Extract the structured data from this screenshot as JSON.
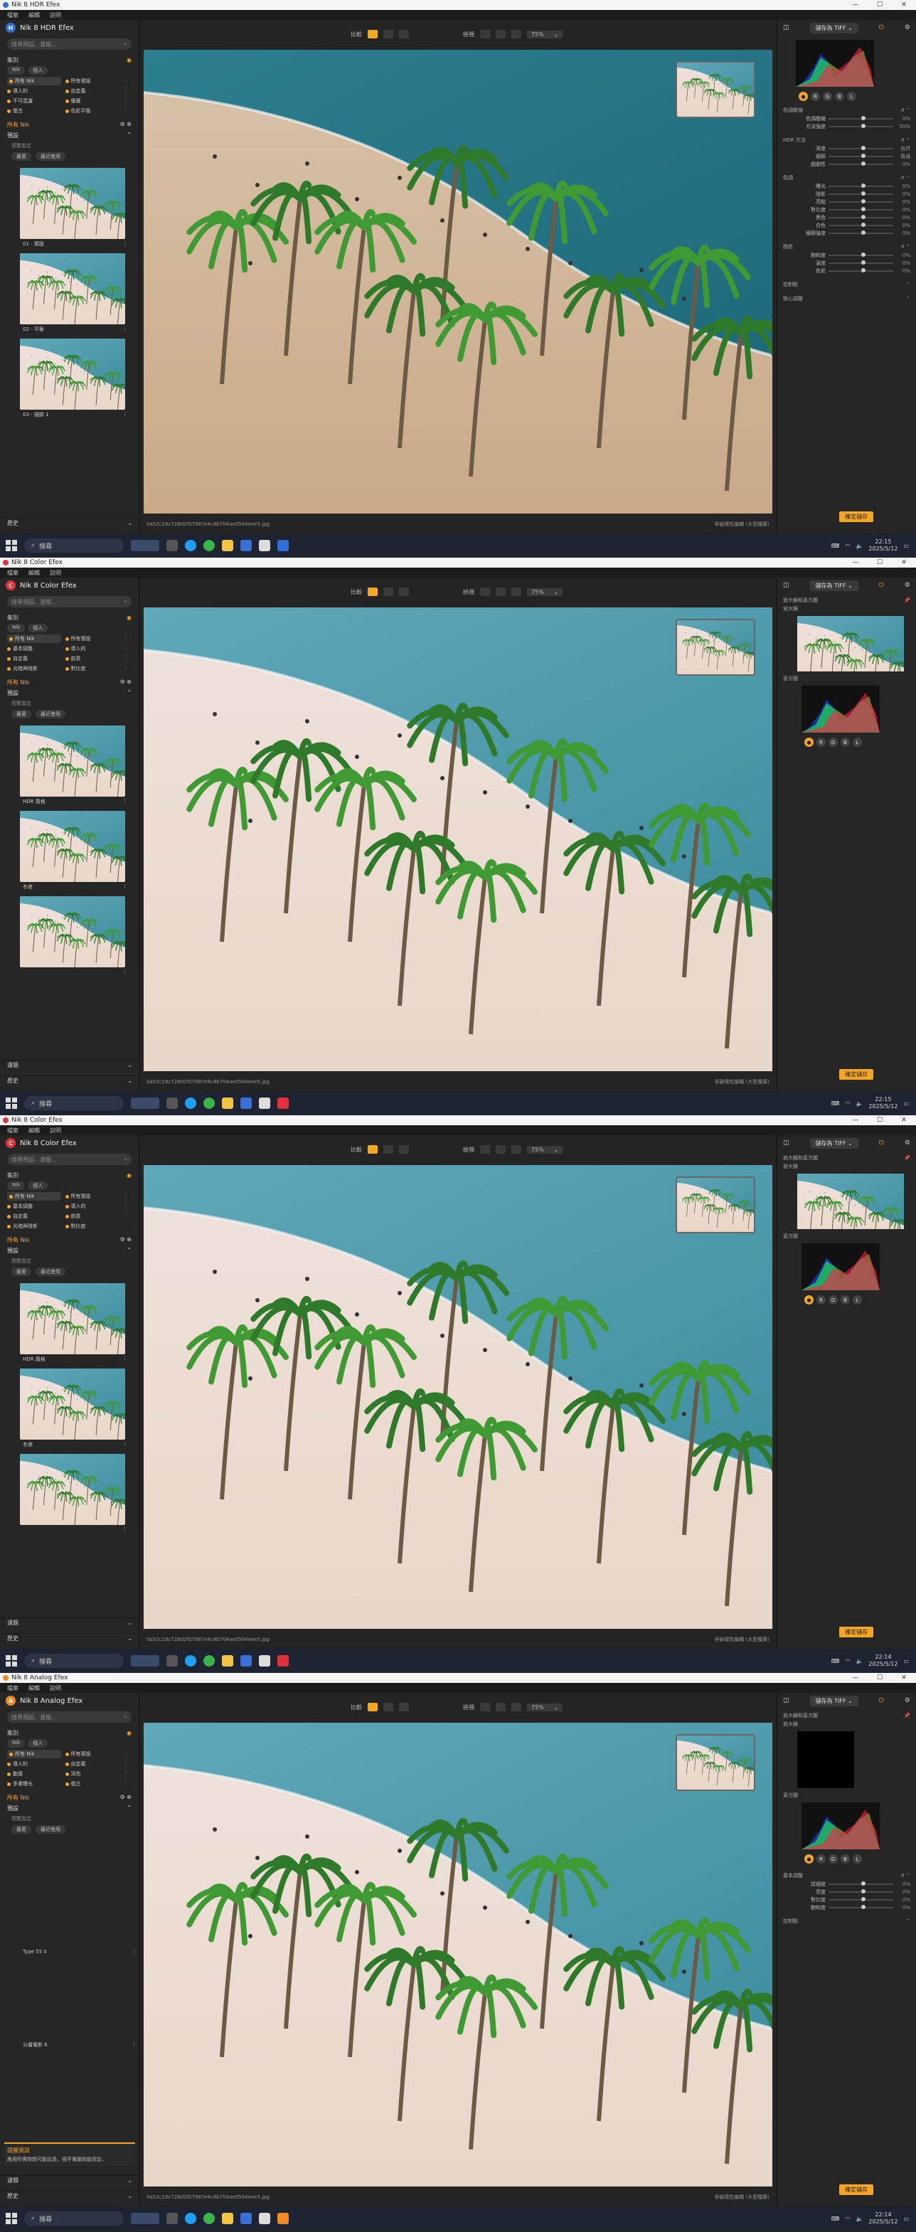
{
  "windows": [
    {
      "title": "Nik 8 HDR Efex",
      "product": "Nik 8 HDR Efex",
      "product_letter": "H",
      "accent": "#2f6fd8",
      "menu": [
        "檔案",
        "編輯",
        "說明"
      ],
      "search_placeholder": "搜尋預設、濾鏡...",
      "collection_label": "集別",
      "tabs": [
        "Nik",
        "個人"
      ],
      "filters": [
        "所有 Nik",
        "所有預設",
        "導入的",
        "自定義",
        "不可混濾",
        "優雅",
        "復古",
        "色彩平衡"
      ],
      "nik_label": "所有 Nik",
      "presets_label": "預設",
      "presets_sub": "預覽設定",
      "preset_pills": [
        "最愛",
        "最近使用"
      ],
      "thumbs": [
        "01 - 預設",
        "02 - 平衡",
        "03 - 細節 1"
      ],
      "bottom_labels": [
        "歷史"
      ],
      "toolbar_compare": "比較",
      "toolbar_view": "檢視",
      "zoom": "75%",
      "filename": "0a52c19c728d2f07987e4c8b704ae0504eee5.jpg",
      "status_right": "非破壞性編輯 (大型檔案)",
      "save_label": "儲存為 TIFF",
      "apply_label": "確定儲存",
      "right_groups": [
        {
          "title": "色調壓縮",
          "rows": [
            [
              "色調壓縮",
              "0%"
            ],
            [
              "方法強度",
              "50%"
            ]
          ]
        },
        {
          "title": "HDR 方法",
          "rows": [
            [
              "深度",
              "自然"
            ],
            [
              "細節",
              "普通"
            ],
            [
              "戲劇性",
              "0%"
            ]
          ]
        },
        {
          "title": "色調",
          "rows": [
            [
              "曝光",
              "0%"
            ],
            [
              "陰影",
              "0%"
            ],
            [
              "亮點",
              "0%"
            ],
            [
              "對比度",
              "0%"
            ],
            [
              "黑色",
              "0%"
            ],
            [
              "白色",
              "0%"
            ],
            [
              "細節強度",
              "0%"
            ]
          ]
        },
        {
          "title": "顏色",
          "rows": [
            [
              "飽和度",
              "0%"
            ],
            [
              "溫度",
              "0%"
            ],
            [
              "色彩",
              "0%"
            ]
          ]
        }
      ],
      "right_footer": [
        "控制點",
        "核心調整"
      ],
      "clock_time": "22:15",
      "clock_date": "2025/5/12",
      "search_label": "搜尋"
    },
    {
      "title": "Nik 8 Color Efex",
      "product": "Nik 8 Color Efex",
      "product_letter": "C",
      "accent": "#e0303a",
      "menu": [
        "檔案",
        "編輯",
        "說明"
      ],
      "search_placeholder": "搜尋預設、濾鏡...",
      "collection_label": "集別",
      "tabs": [
        "Nik",
        "個人"
      ],
      "filters": [
        "所有 Nik",
        "所有預設",
        "基本調整",
        "導入的",
        "自定義",
        "創意",
        "光暗與陰影",
        "對比度"
      ],
      "nik_label": "所有 Nik",
      "presets_label": "預設",
      "presets_sub": "預覽設定",
      "preset_pills": [
        "最愛",
        "最近使用"
      ],
      "thumbs": [
        "HDR 風格",
        "冬夜",
        ""
      ],
      "bottom_labels": [
        "濾鏡",
        "歷史"
      ],
      "toolbar_compare": "比較",
      "toolbar_view": "檢視",
      "zoom": "75%",
      "filename": "0a52c19c728d2f07987e4c8b704ae0504eee5.jpg",
      "status_right": "非破壞性編輯 (大型檔案)",
      "save_label": "儲存為 TIFF",
      "apply_label": "確定儲存",
      "loupe_title": "放大鏡和直方圖",
      "loupe_sub": "放大鏡",
      "hist_sub": "直方圖",
      "clock_time": "22:15",
      "clock_date": "2025/5/12",
      "search_label": "搜尋"
    },
    {
      "title": "Nik 8 Color Efex",
      "product": "Nik 8 Color Efex",
      "product_letter": "C",
      "accent": "#e0303a",
      "menu": [
        "檔案",
        "編輯",
        "說明"
      ],
      "search_placeholder": "搜尋預設、濾鏡...",
      "collection_label": "集別",
      "tabs": [
        "Nik",
        "個人"
      ],
      "filters": [
        "所有 Nik",
        "所有預設",
        "基本調整",
        "導入的",
        "自定義",
        "創意",
        "光暗與陰影",
        "對比度"
      ],
      "nik_label": "所有 Nik",
      "presets_label": "預設",
      "presets_sub": "預覽設定",
      "preset_pills": [
        "最愛",
        "最近使用"
      ],
      "thumbs": [
        "HDR 風格",
        "冬夜",
        ""
      ],
      "bottom_labels": [
        "濾鏡",
        "歷史"
      ],
      "toolbar_compare": "比較",
      "toolbar_view": "檢視",
      "zoom": "75%",
      "filename": "0a52c19c728d2f07987e4c8b704ae0504eee5.jpg",
      "status_right": "非破壞性編輯 (大型檔案)",
      "save_label": "儲存為 TIFF",
      "apply_label": "確定儲存",
      "loupe_title": "放大鏡和直方圖",
      "loupe_sub": "放大鏡",
      "hist_sub": "直方圖",
      "clock_time": "22:14",
      "clock_date": "2025/5/12",
      "search_label": "搜尋"
    },
    {
      "title": "Nik 8 Analog Efex",
      "product": "Nik 8 Analog Efex",
      "product_letter": "A",
      "accent": "#f58a23",
      "menu": [
        "檔案",
        "編輯",
        "說明"
      ],
      "search_placeholder": "搜尋預設、濾鏡...",
      "collection_label": "集別",
      "tabs": [
        "Nik",
        "個人"
      ],
      "filters": [
        "所有 Nik",
        "所有預設",
        "導入的",
        "自定義",
        "動感",
        "深色",
        "多重曝光",
        "復古"
      ],
      "nik_label": "所有 Nik",
      "presets_label": "預設",
      "presets_sub": "預覽設定",
      "preset_pills": [
        "最愛",
        "最近使用"
      ],
      "thumbs": [
        "Type 55 II",
        "分層電影 6"
      ],
      "bottom_labels": [
        "濾鏡",
        "歷史"
      ],
      "tip_title": "提醒資訊",
      "tip_text": "應用所需時間可能延長，視乎電腦效能而定。",
      "toolbar_compare": "比較",
      "toolbar_view": "檢視",
      "zoom": "75%",
      "filename": "0a52c19c728d2f07987e4c8b704ae0504eee5.jpg",
      "status_right": "非破壞性編輯 (大型檔案)",
      "save_label": "儲存為 TIFF",
      "apply_label": "確定儲存",
      "loupe_title": "放大鏡和直方圖",
      "loupe_sub": "放大鏡",
      "hist_sub": "直方圖",
      "base_group": {
        "title": "基本調整",
        "rows": [
          [
            "詳細度",
            "0%"
          ],
          [
            "亮度",
            "0%"
          ],
          [
            "對比度",
            "0%"
          ],
          [
            "飽和度",
            "0%"
          ]
        ]
      },
      "right_footer": [
        "控制點"
      ],
      "clock_time": "22:14",
      "clock_date": "2025/5/12",
      "search_label": "搜尋"
    }
  ]
}
